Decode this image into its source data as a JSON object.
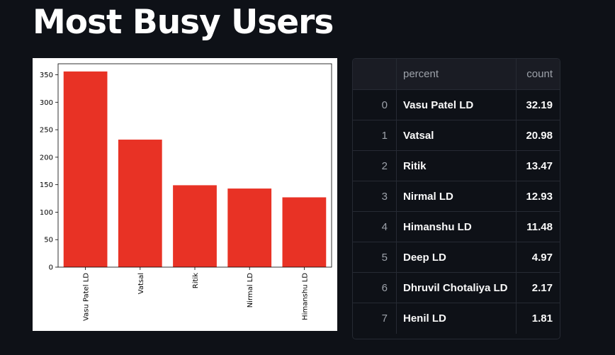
{
  "page": {
    "title": "Most Busy Users"
  },
  "chart_data": {
    "type": "bar",
    "categories": [
      "Vasu Patel LD",
      "Vatsal",
      "Ritik",
      "Nirmal LD",
      "Himanshu LD"
    ],
    "values": [
      356,
      232,
      149,
      143,
      127
    ],
    "ylim": [
      0,
      370
    ],
    "yticks": [
      0,
      50,
      100,
      150,
      200,
      250,
      300,
      350
    ],
    "color": "#e83225",
    "xlabel": "",
    "ylabel": "",
    "title": ""
  },
  "table": {
    "columns": [
      "",
      "percent",
      "count"
    ],
    "rows": [
      {
        "index": "0",
        "percent": "Vasu Patel LD",
        "count": "32.19"
      },
      {
        "index": "1",
        "percent": "Vatsal",
        "count": "20.98"
      },
      {
        "index": "2",
        "percent": "Ritik",
        "count": "13.47"
      },
      {
        "index": "3",
        "percent": "Nirmal LD",
        "count": "12.93"
      },
      {
        "index": "4",
        "percent": "Himanshu LD",
        "count": "11.48"
      },
      {
        "index": "5",
        "percent": "Deep LD",
        "count": "4.97"
      },
      {
        "index": "6",
        "percent": "Dhruvil Chotaliya LD",
        "count": "2.17"
      },
      {
        "index": "7",
        "percent": "Henil LD",
        "count": "1.81"
      }
    ]
  }
}
